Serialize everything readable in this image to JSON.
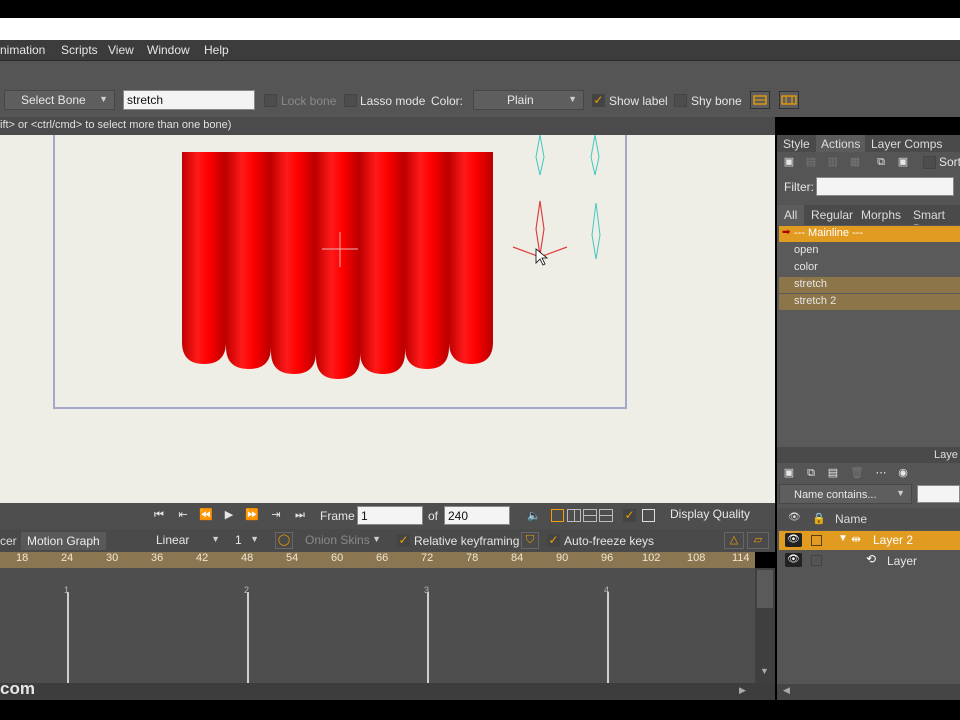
{
  "menu": [
    "nimation",
    "Scripts",
    "View",
    "Window",
    "Help"
  ],
  "toolbar": {
    "select_bone": "Select Bone",
    "bone_name_value": "stretch",
    "lock_bone": "Lock bone",
    "lasso_mode": "Lasso mode",
    "color_label": "Color:",
    "color_value": "Plain",
    "show_label": "Show label",
    "shy_bone": "Shy bone"
  },
  "status_text": "ift> or <ctrl/cmd> to select more than one bone)",
  "transport": {
    "frame_label": "Frame",
    "frame_value": "1",
    "of_label": "of",
    "total_value": "240",
    "display_quality": "Display Quality"
  },
  "timeline_bar": {
    "cer": "cer",
    "motion_graph": "Motion Graph",
    "interp": "Linear",
    "interp_num": "1",
    "onion_skins": "Onion Skins",
    "relative_keyframing": "Relative keyframing",
    "auto_freeze": "Auto-freeze keys"
  },
  "ruler_ticks": [
    "18",
    "24",
    "30",
    "36",
    "42",
    "48",
    "54",
    "60",
    "66",
    "72",
    "78",
    "84",
    "90",
    "96",
    "102",
    "108",
    "114"
  ],
  "track_markers": [
    "1",
    "2",
    "3",
    "4"
  ],
  "watermark": "com",
  "right_panel": {
    "tabs": [
      "Style",
      "Actions",
      "Layer Comps"
    ],
    "sort": "Sort",
    "filter_label": "Filter:",
    "filter_tabs": [
      "All",
      "Regular",
      "Morphs",
      "Smart Bo"
    ],
    "actions": [
      {
        "label": "--- Mainline ---",
        "state": "mainline"
      },
      {
        "label": "open",
        "state": "normal"
      },
      {
        "label": "color",
        "state": "normal"
      },
      {
        "label": "stretch",
        "state": "selected"
      },
      {
        "label": "stretch 2",
        "state": "selected"
      }
    ],
    "layers_title": "Laye",
    "name_contains": "Name contains...",
    "col_name": "Name",
    "layers": [
      {
        "label": "Layer 2",
        "state": "selected"
      },
      {
        "label": "Layer",
        "state": "normal"
      }
    ]
  },
  "colors": {
    "accent": "#f0a000",
    "curtain": "#ff0000",
    "selected_row": "#8c7548",
    "mainline_row": "#e09b20"
  }
}
